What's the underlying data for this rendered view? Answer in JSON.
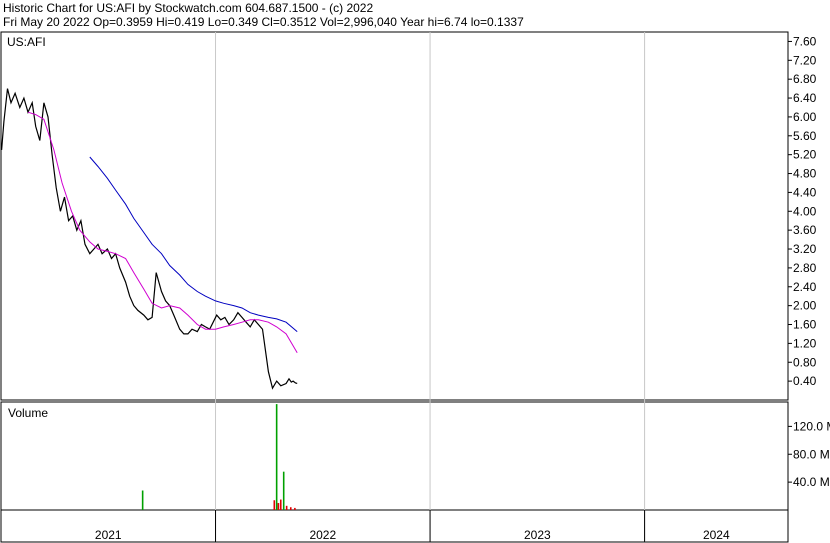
{
  "header": {
    "line1": "Historic Chart for US:AFI by Stockwatch.com 604.687.1500 - (c) 2022",
    "line2": "Fri May 20 2022   Op=0.3959   Hi=0.419   Lo=0.349   Cl=0.3512   Vol=2,996,040   Year hi=6.74   lo=0.1337"
  },
  "chart_data": [
    {
      "type": "line",
      "title": "US:AFI",
      "ylim": [
        0,
        7.8
      ],
      "yticks": [
        "7.60",
        "7.20",
        "6.80",
        "6.40",
        "6.00",
        "5.60",
        "5.20",
        "4.80",
        "4.40",
        "4.00",
        "3.60",
        "3.20",
        "2.80",
        "2.40",
        "2.00",
        "1.60",
        "1.20",
        "0.80",
        "0.40"
      ],
      "xticks": [
        "2021",
        "2022",
        "2023",
        "2024"
      ],
      "grid": true,
      "series": [
        {
          "color": "#000000",
          "x": [
            "2021-01-02",
            "2021-01-06",
            "2021-01-12",
            "2021-01-18",
            "2021-01-25",
            "2021-02-02",
            "2021-02-09",
            "2021-02-16",
            "2021-02-23",
            "2021-03-01",
            "2021-03-08",
            "2021-03-15",
            "2021-03-22",
            "2021-03-29",
            "2021-04-05",
            "2021-04-12",
            "2021-04-19",
            "2021-04-26",
            "2021-05-03",
            "2021-05-10",
            "2021-05-17",
            "2021-05-24",
            "2021-06-01",
            "2021-06-08",
            "2021-06-15",
            "2021-06-22",
            "2021-07-01",
            "2021-07-08",
            "2021-07-15",
            "2021-07-22",
            "2021-08-01",
            "2021-08-08",
            "2021-08-15",
            "2021-08-22",
            "2021-09-01",
            "2021-09-08",
            "2021-09-15",
            "2021-09-22",
            "2021-10-01",
            "2021-10-08",
            "2021-10-15",
            "2021-10-22",
            "2021-11-01",
            "2021-11-08",
            "2021-11-15",
            "2021-11-22",
            "2021-12-01",
            "2021-12-08",
            "2021-12-15",
            "2021-12-22",
            "2022-01-03",
            "2022-01-10",
            "2022-01-17",
            "2022-01-24",
            "2022-02-01",
            "2022-02-08",
            "2022-02-15",
            "2022-02-22",
            "2022-03-01",
            "2022-03-08",
            "2022-03-15",
            "2022-03-22",
            "2022-04-01",
            "2022-04-08",
            "2022-04-15",
            "2022-04-22",
            "2022-05-01",
            "2022-05-06",
            "2022-05-10",
            "2022-05-13",
            "2022-05-17",
            "2022-05-20"
          ],
          "y": [
            5.3,
            5.9,
            6.6,
            6.3,
            6.5,
            6.2,
            6.4,
            6.1,
            6.3,
            5.8,
            5.5,
            6.3,
            6.0,
            5.2,
            4.5,
            4.0,
            4.3,
            3.8,
            3.9,
            3.6,
            3.8,
            3.3,
            3.1,
            3.2,
            3.3,
            3.1,
            3.2,
            3.0,
            3.1,
            2.8,
            2.5,
            2.2,
            2.0,
            1.9,
            1.8,
            1.7,
            1.75,
            2.7,
            2.3,
            2.1,
            2.0,
            1.8,
            1.5,
            1.4,
            1.4,
            1.5,
            1.45,
            1.6,
            1.55,
            1.5,
            1.8,
            1.7,
            1.75,
            1.6,
            1.7,
            1.85,
            1.75,
            1.65,
            1.55,
            1.7,
            1.6,
            1.5,
            0.6,
            0.25,
            0.4,
            0.3,
            0.35,
            0.45,
            0.38,
            0.4,
            0.36,
            0.3512
          ]
        },
        {
          "color": "#d000d0",
          "x": [
            "2021-02-16",
            "2021-03-01",
            "2021-03-15",
            "2021-04-01",
            "2021-04-15",
            "2021-05-01",
            "2021-05-15",
            "2021-06-01",
            "2021-06-15",
            "2021-07-01",
            "2021-07-15",
            "2021-08-01",
            "2021-08-15",
            "2021-09-01",
            "2021-09-15",
            "2021-10-01",
            "2021-10-15",
            "2021-11-01",
            "2021-11-15",
            "2021-12-01",
            "2021-12-15",
            "2022-01-01",
            "2022-01-15",
            "2022-02-01",
            "2022-02-15",
            "2022-03-01",
            "2022-03-15",
            "2022-04-01",
            "2022-04-15",
            "2022-05-01",
            "2022-05-20"
          ],
          "y": [
            6.1,
            6.05,
            5.95,
            5.3,
            4.6,
            4.0,
            3.6,
            3.35,
            3.2,
            3.15,
            3.1,
            3.0,
            2.7,
            2.35,
            2.05,
            1.95,
            2.0,
            1.95,
            1.8,
            1.6,
            1.5,
            1.5,
            1.55,
            1.6,
            1.65,
            1.7,
            1.7,
            1.65,
            1.55,
            1.4,
            1.0
          ]
        },
        {
          "color": "#0000c0",
          "x": [
            "2021-06-01",
            "2021-06-15",
            "2021-07-01",
            "2021-07-15",
            "2021-08-01",
            "2021-08-15",
            "2021-09-01",
            "2021-09-15",
            "2021-10-01",
            "2021-10-15",
            "2021-11-01",
            "2021-11-15",
            "2021-12-01",
            "2021-12-15",
            "2022-01-01",
            "2022-01-15",
            "2022-02-01",
            "2022-02-15",
            "2022-03-01",
            "2022-03-15",
            "2022-04-01",
            "2022-04-15",
            "2022-05-01",
            "2022-05-20"
          ],
          "y": [
            5.15,
            4.95,
            4.7,
            4.45,
            4.15,
            3.85,
            3.55,
            3.3,
            3.1,
            2.85,
            2.65,
            2.45,
            2.3,
            2.2,
            2.1,
            2.05,
            2.0,
            1.95,
            1.85,
            1.8,
            1.75,
            1.72,
            1.65,
            1.45
          ]
        }
      ]
    },
    {
      "type": "bar",
      "title": "Volume",
      "ylim": [
        0,
        155
      ],
      "yticks": [
        "120.0 M",
        "80.0 M",
        "40.0 M"
      ],
      "colors": {
        "up": "#00a000",
        "down": "#e00000"
      },
      "bars": [
        {
          "x": "2021-08-30",
          "v": 28,
          "dir": "up"
        },
        {
          "x": "2022-04-11",
          "v": 14,
          "dir": "down"
        },
        {
          "x": "2022-04-15",
          "v": 152,
          "dir": "up"
        },
        {
          "x": "2022-04-18",
          "v": 10,
          "dir": "down"
        },
        {
          "x": "2022-04-22",
          "v": 15,
          "dir": "down"
        },
        {
          "x": "2022-04-27",
          "v": 55,
          "dir": "up"
        },
        {
          "x": "2022-05-02",
          "v": 6,
          "dir": "down"
        },
        {
          "x": "2022-05-09",
          "v": 4,
          "dir": "down"
        },
        {
          "x": "2022-05-16",
          "v": 3,
          "dir": "down"
        }
      ]
    }
  ]
}
